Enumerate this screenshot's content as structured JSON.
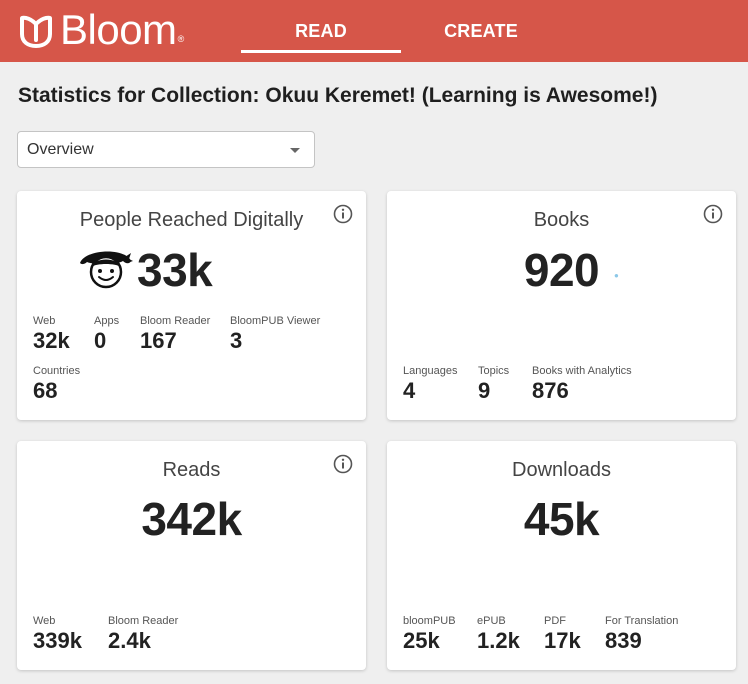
{
  "header": {
    "logo_text": "Bloom",
    "logo_mark": "®",
    "tabs": [
      {
        "label": "READ",
        "active": true
      },
      {
        "label": "CREATE",
        "active": false
      }
    ],
    "colors": {
      "bar": "#d65649",
      "text": "#ffffff"
    }
  },
  "page": {
    "title": "Statistics for Collection: Okuu Keremet! (Learning is Awesome!)"
  },
  "view_select": {
    "value": "Overview"
  },
  "cards": {
    "people": {
      "title": "People Reached Digitally",
      "total": "33k",
      "icon": "reader-face-icon",
      "stats": [
        {
          "label": "Web",
          "value": "32k"
        },
        {
          "label": "Apps",
          "value": "0"
        },
        {
          "label": "Bloom Reader",
          "value": "167"
        },
        {
          "label": "BloomPUB Viewer",
          "value": "3"
        },
        {
          "label": "Countries",
          "value": "68"
        }
      ]
    },
    "books": {
      "title": "Books",
      "total": "920",
      "stats": [
        {
          "label": "Languages",
          "value": "4"
        },
        {
          "label": "Topics",
          "value": "9"
        },
        {
          "label": "Books with Analytics",
          "value": "876"
        }
      ]
    },
    "reads": {
      "title": "Reads",
      "total": "342k",
      "stats": [
        {
          "label": "Web",
          "value": "339k"
        },
        {
          "label": "Bloom Reader",
          "value": "2.4k"
        }
      ]
    },
    "downloads": {
      "title": "Downloads",
      "total": "45k",
      "stats": [
        {
          "label": "bloomPUB",
          "value": "25k"
        },
        {
          "label": "ePUB",
          "value": "1.2k"
        },
        {
          "label": "PDF",
          "value": "17k"
        },
        {
          "label": "For Translation",
          "value": "839"
        }
      ]
    }
  }
}
